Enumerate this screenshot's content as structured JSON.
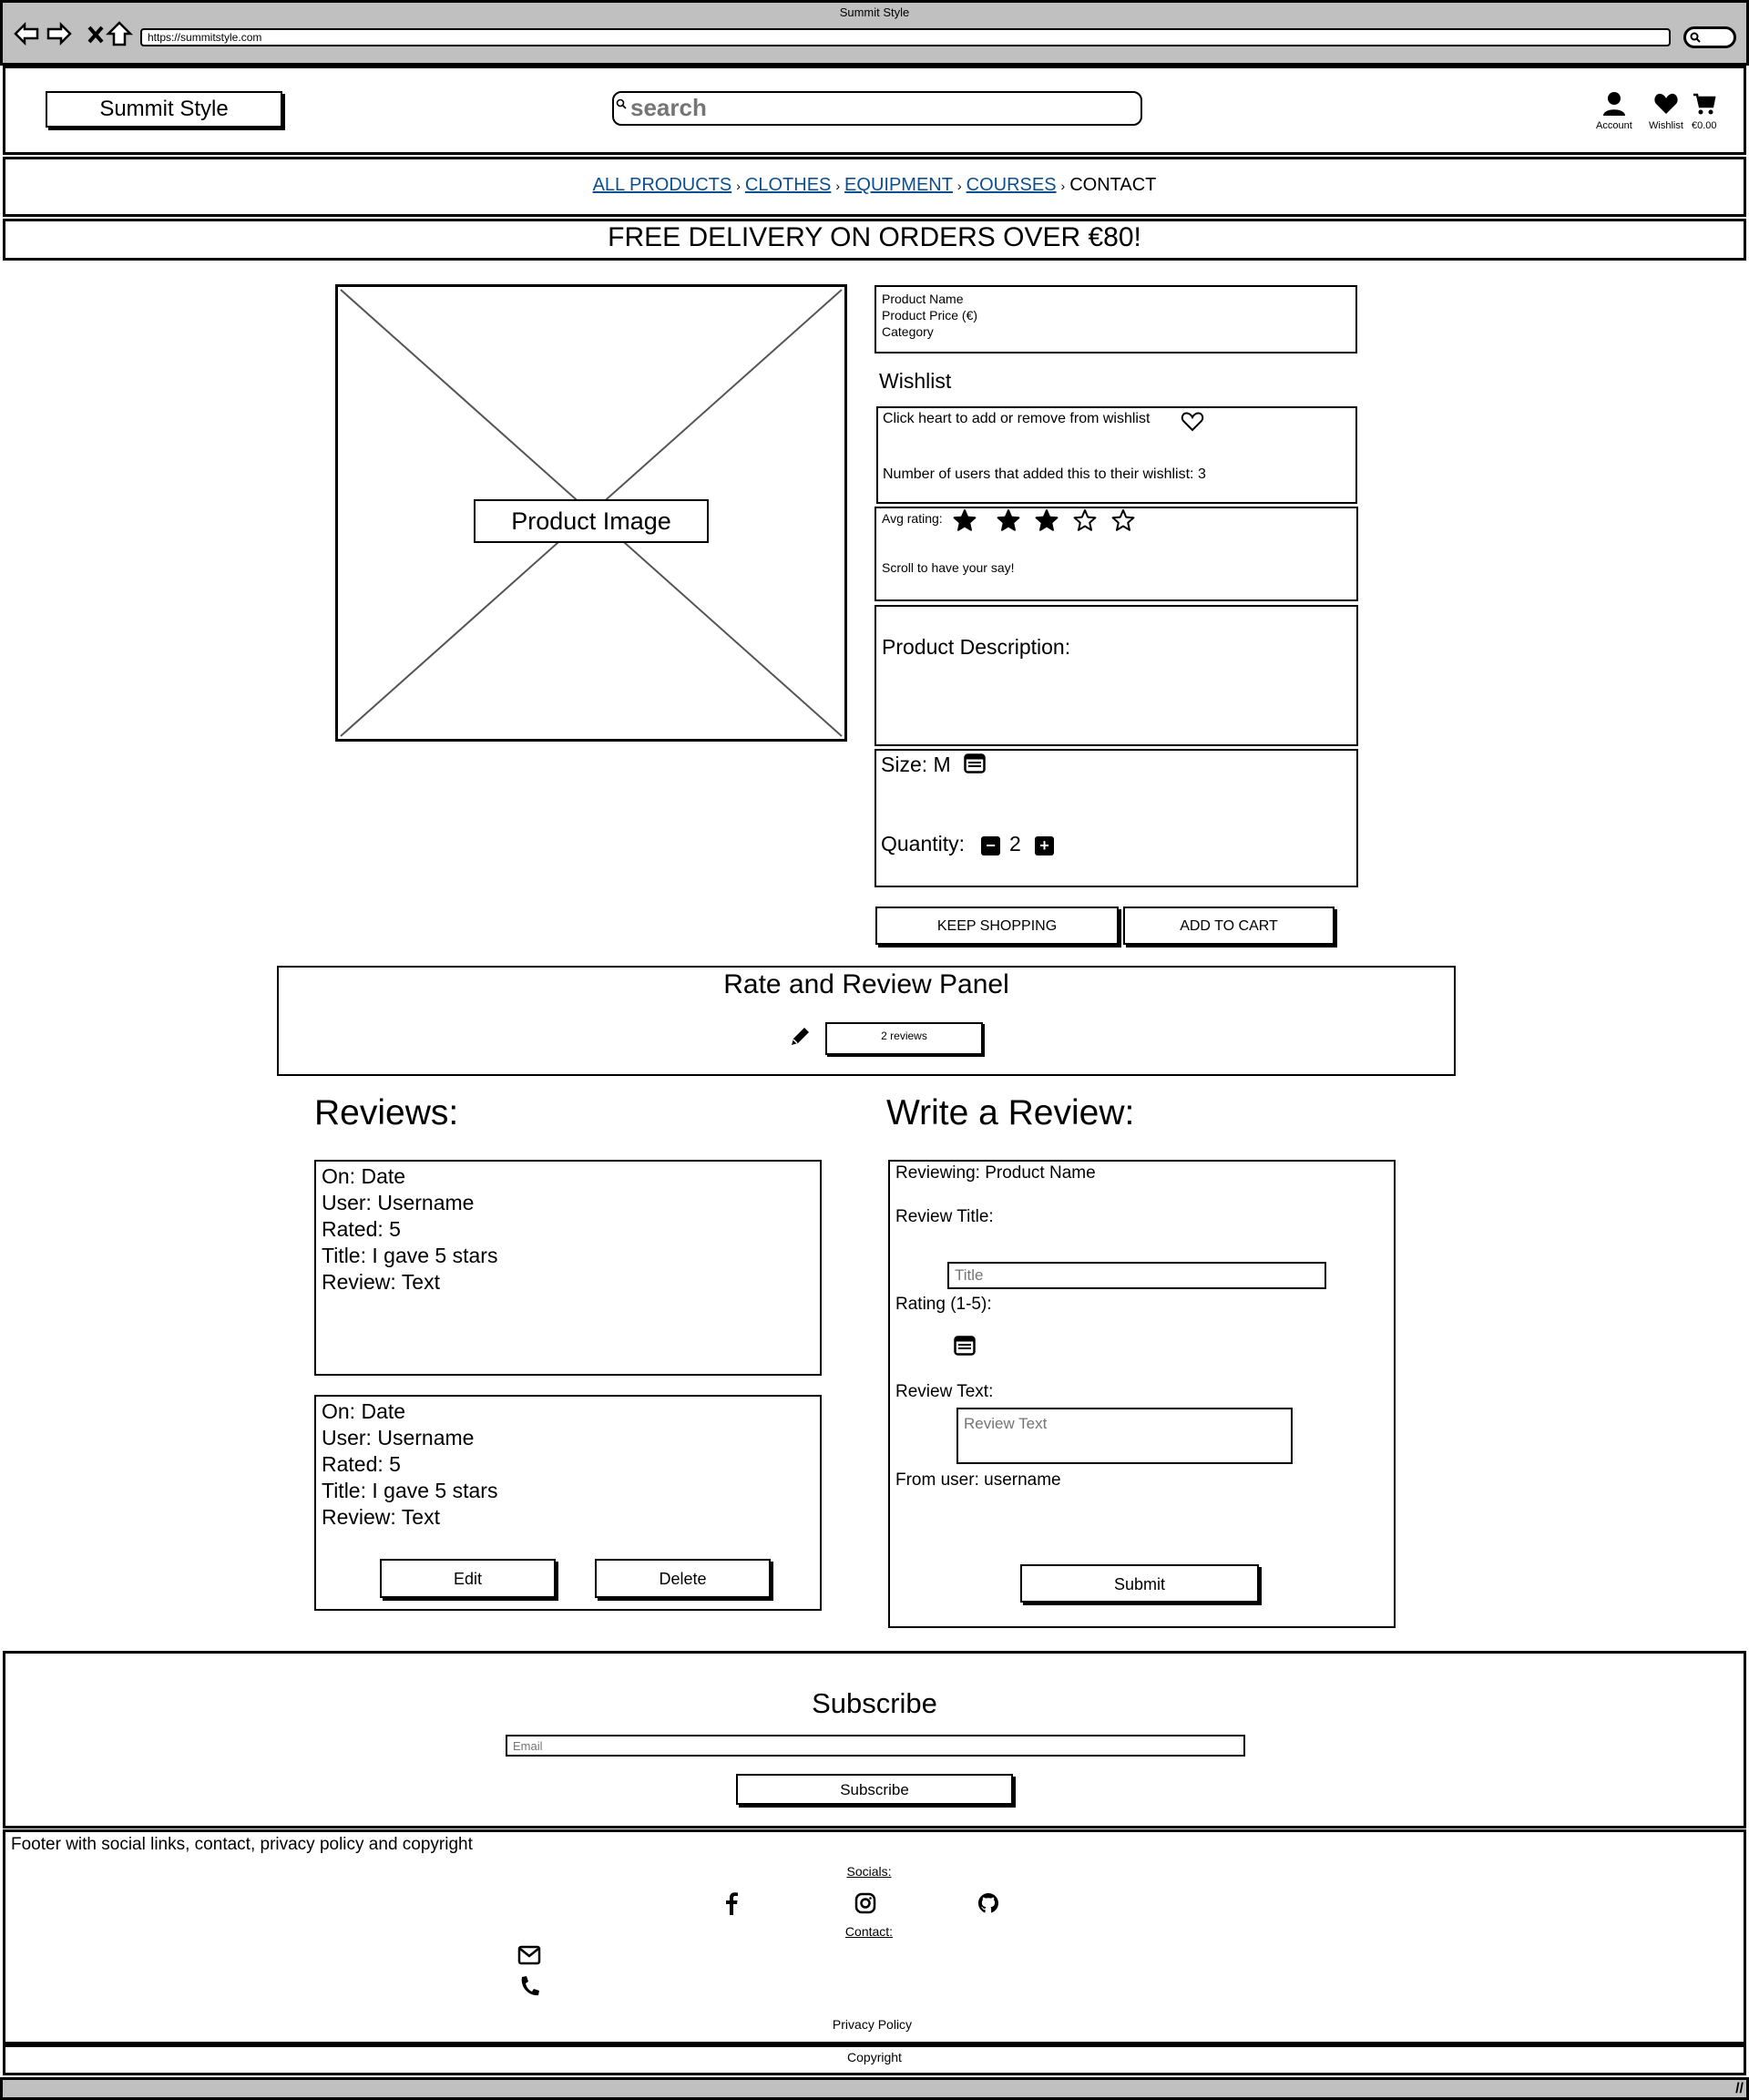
{
  "browser": {
    "window_title": "Summit Style",
    "url": "https://summitstyle.com"
  },
  "header": {
    "logo": "Summit Style",
    "search_placeholder": "search",
    "account_label": "Account",
    "wishlist_label": "Wishlist",
    "cart_total": "€0.00"
  },
  "breadcrumb": {
    "items": [
      {
        "label": "ALL PRODUCTS",
        "link": true
      },
      {
        "label": "CLOTHES",
        "link": true
      },
      {
        "label": "EQUIPMENT",
        "link": true
      },
      {
        "label": "COURSES",
        "link": true
      },
      {
        "label": "CONTACT",
        "link": false
      }
    ],
    "separator": "›",
    "link_color": "#0b4f91"
  },
  "banner": {
    "text": "FREE DELIVERY ON ORDERS OVER €80!"
  },
  "product": {
    "image_label": "Product Image",
    "name": "Product Name",
    "price": "Product Price (€)",
    "category": "Category",
    "description_label": "Product Description:",
    "size_label": "Size:",
    "size_value": "M",
    "quantity_label": "Quantity:",
    "quantity_value": "2",
    "keep_shopping_label": "KEEP SHOPPING",
    "add_to_cart_label": "ADD TO CART"
  },
  "wishlist": {
    "heading": "Wishlist",
    "instruction": "Click heart to add or remove from wishlist",
    "count_text": "Number of users that added this to their wishlist: 3"
  },
  "rating": {
    "label": "Avg rating:",
    "value": 3,
    "max": 5,
    "prompt": "Scroll to have your say!"
  },
  "rate_panel": {
    "title": "Rate and Review Panel",
    "reviews_count": "2 reviews"
  },
  "reviews": {
    "heading": "Reviews:",
    "items": [
      {
        "date": "On: Date",
        "user": "User: Username",
        "rated": "Rated: 5",
        "title": "Title: I gave 5 stars",
        "text": "Review: Text"
      },
      {
        "date": "On: Date",
        "user": "User: Username",
        "rated": "Rated: 5",
        "title": "Title: I gave 5 stars",
        "text": "Review: Text",
        "edit_label": "Edit",
        "delete_label": "Delete"
      }
    ]
  },
  "write_review": {
    "heading": "Write a Review:",
    "reviewing": "Reviewing: Product Name",
    "title_label": "Review Title:",
    "title_placeholder": "Title",
    "rating_label": "Rating (1-5):",
    "text_label": "Review Text:",
    "text_placeholder": "Review Text",
    "from_user": "From user: username",
    "submit_label": "Submit"
  },
  "subscribe": {
    "heading": "Subscribe",
    "email_placeholder": "Email",
    "button_label": "Subscribe"
  },
  "footer": {
    "note": "Footer with social links, contact, privacy policy and copyright",
    "socials_heading": "Socials:",
    "socials": [
      "facebook-icon",
      "instagram-icon",
      "github-icon"
    ],
    "contact_heading": "Contact:",
    "contacts": [
      "envelope-icon",
      "phone-icon"
    ],
    "privacy_label": "Privacy Policy",
    "copyright_label": "Copyright"
  }
}
